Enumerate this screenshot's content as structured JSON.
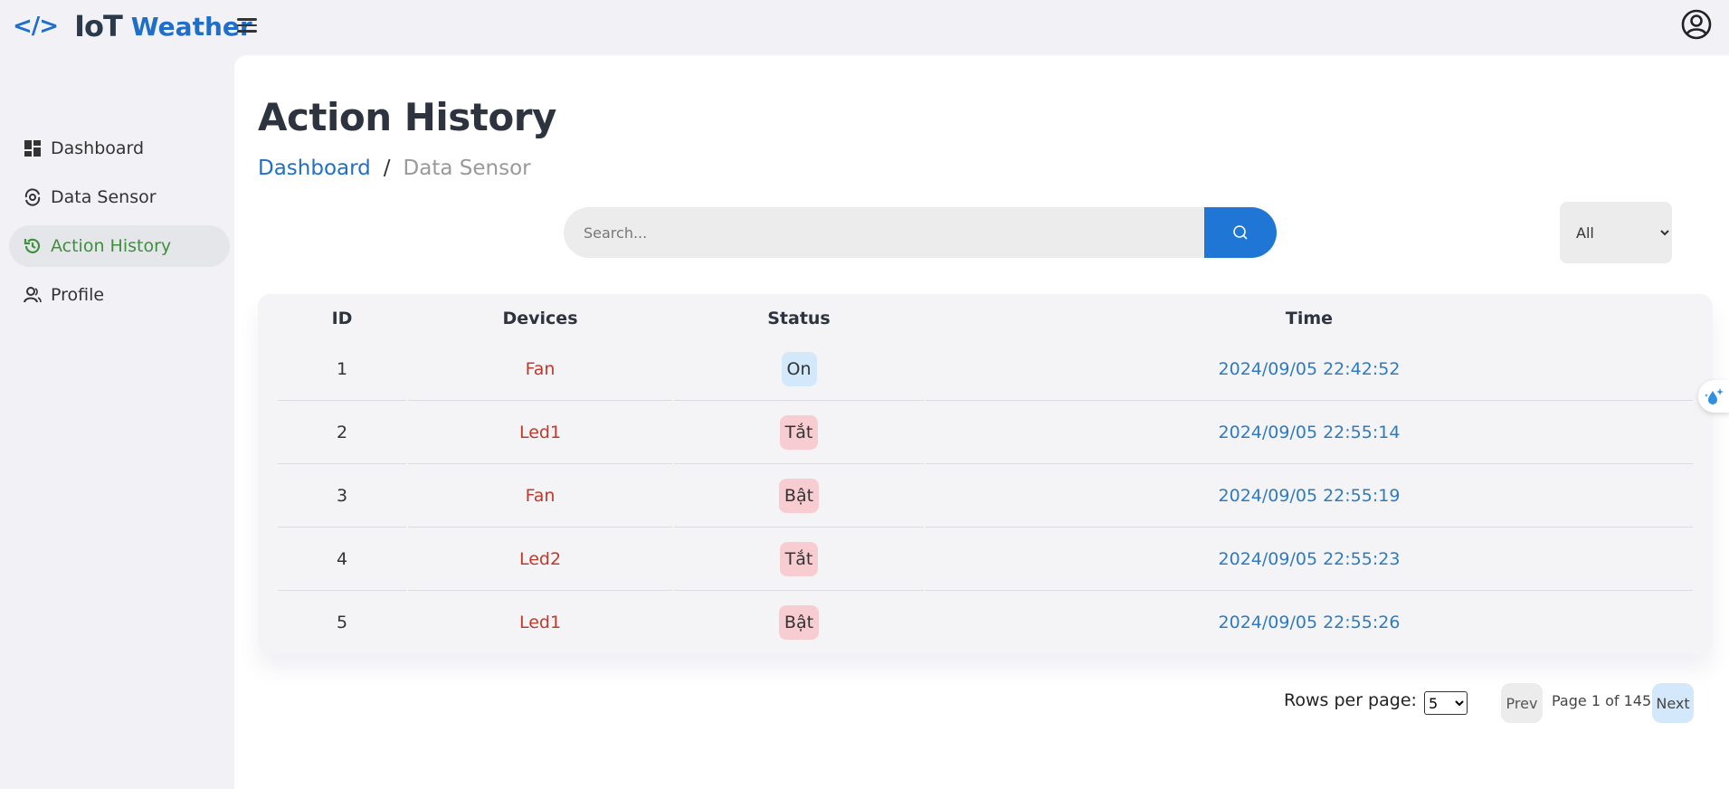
{
  "header": {
    "logo_code": "</>",
    "logo_iot": "IoT",
    "logo_weather": "Weather"
  },
  "sidebar": {
    "items": [
      {
        "label": "Dashboard",
        "icon": "dashboard-icon"
      },
      {
        "label": "Data Sensor",
        "icon": "sensor-icon"
      },
      {
        "label": "Action History",
        "icon": "history-icon",
        "active": true
      },
      {
        "label": "Profile",
        "icon": "profile-icon"
      }
    ]
  },
  "main": {
    "title": "Action History",
    "breadcrumb": {
      "link": "Dashboard",
      "separator": "/",
      "current": "Data Sensor"
    },
    "search": {
      "placeholder": "Search...",
      "value": ""
    },
    "filter": {
      "selected": "All"
    },
    "table": {
      "headers": {
        "id": "ID",
        "devices": "Devices",
        "status": "Status",
        "time": "Time"
      },
      "rows": [
        {
          "id": "1",
          "device": "Fan",
          "status": "On",
          "time": "2024/09/05 22:42:52"
        },
        {
          "id": "2",
          "device": "Led1",
          "status": "Tắt",
          "time": "2024/09/05 22:55:14"
        },
        {
          "id": "3",
          "device": "Fan",
          "status": "Bật",
          "time": "2024/09/05 22:55:19"
        },
        {
          "id": "4",
          "device": "Led2",
          "status": "Tắt",
          "time": "2024/09/05 22:55:23"
        },
        {
          "id": "5",
          "device": "Led1",
          "status": "Bật",
          "time": "2024/09/05 22:55:26"
        }
      ]
    },
    "pagination": {
      "rows_label": "Rows per page:",
      "rows_value": "5",
      "prev": "Prev",
      "page_info": "Page 1 of 145",
      "next": "Next"
    }
  },
  "colors": {
    "accent": "#1f76d4",
    "active_nav": "#3f8f3f",
    "device_text": "#c0392b",
    "time_text": "#2f7bbf",
    "status_on_bg": "#d3e8fb",
    "status_off_bg": "#f8cdd2"
  }
}
